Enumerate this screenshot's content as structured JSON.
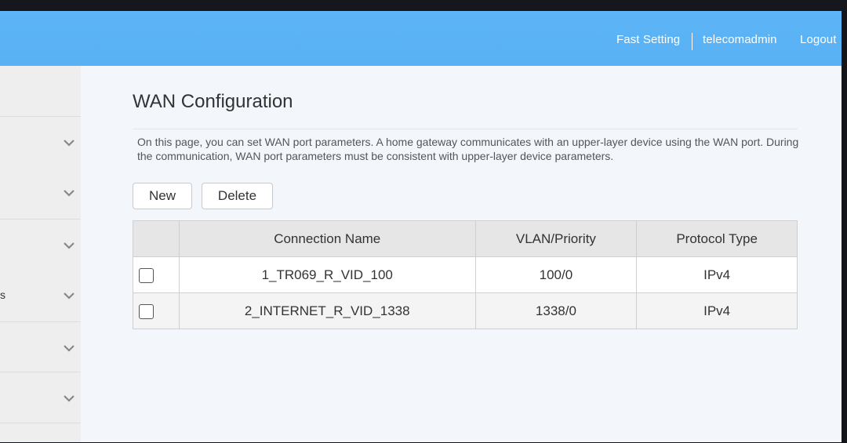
{
  "header": {
    "links": {
      "fast_setting": "Fast Setting",
      "user": "telecomadmin",
      "logout": "Logout"
    },
    "background_color": "#5bb3f6"
  },
  "sidebar": {
    "items": [
      {
        "label": "",
        "icon": "chevron-down-icon"
      },
      {
        "label": "",
        "icon": "chevron-down-icon"
      },
      {
        "label": "",
        "icon": "chevron-down-icon"
      },
      {
        "label": "s",
        "icon": "chevron-down-icon"
      },
      {
        "label": "",
        "icon": "chevron-down-icon"
      },
      {
        "label": "",
        "icon": "chevron-down-icon"
      }
    ]
  },
  "main": {
    "title": "WAN Configuration",
    "description": "On this page, you can set WAN port parameters. A home gateway communicates with an upper-layer device using the WAN port. During the communication, WAN port parameters must be consistent with upper-layer device parameters.",
    "buttons": {
      "new": "New",
      "delete": "Delete"
    },
    "table": {
      "columns": [
        "",
        "Connection Name",
        "VLAN/Priority",
        "Protocol Type"
      ],
      "rows": [
        {
          "checked": false,
          "connection_name": "1_TR069_R_VID_100",
          "vlan_priority": "100/0",
          "protocol_type": "IPv4"
        },
        {
          "checked": false,
          "connection_name": "2_INTERNET_R_VID_1338",
          "vlan_priority": "1338/0",
          "protocol_type": "IPv4"
        }
      ]
    }
  }
}
